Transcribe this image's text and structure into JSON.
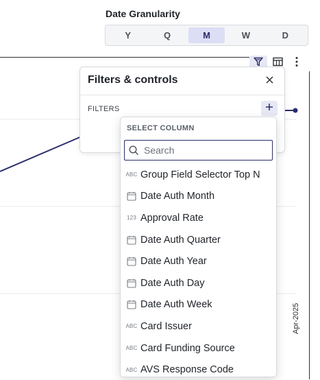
{
  "granularity": {
    "label": "Date Granularity",
    "options": [
      "Y",
      "Q",
      "M",
      "W",
      "D"
    ],
    "selected": "M"
  },
  "chart": {
    "x_tick": "Apr-2025",
    "line_color": "#2a2d6b"
  },
  "toolbar": {
    "icons": [
      "filter-icon",
      "table-icon",
      "more-icon"
    ]
  },
  "filters_panel": {
    "title": "Filters & controls",
    "section": "FILTERS"
  },
  "dropdown": {
    "heading": "SELECT COLUMN",
    "search_placeholder": "Search",
    "items": [
      {
        "type": "text",
        "type_glyph": "ABC",
        "label": "Group Field Selector Top N"
      },
      {
        "type": "date",
        "type_glyph": "31",
        "label": "Date Auth Month"
      },
      {
        "type": "number",
        "type_glyph": "123",
        "label": "Approval Rate"
      },
      {
        "type": "date",
        "type_glyph": "31",
        "label": "Date Auth Quarter"
      },
      {
        "type": "date",
        "type_glyph": "31",
        "label": "Date Auth Year"
      },
      {
        "type": "date",
        "type_glyph": "31",
        "label": "Date Auth Day"
      },
      {
        "type": "date",
        "type_glyph": "31",
        "label": "Date Auth Week"
      },
      {
        "type": "text",
        "type_glyph": "ABC",
        "label": "Card Issuer"
      },
      {
        "type": "text",
        "type_glyph": "ABC",
        "label": "Card Funding Source"
      },
      {
        "type": "text",
        "type_glyph": "ABC",
        "label": "AVS Response Code"
      }
    ]
  }
}
